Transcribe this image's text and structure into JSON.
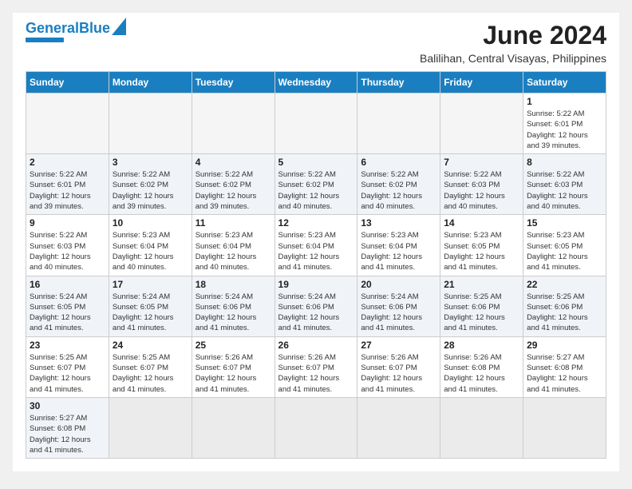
{
  "header": {
    "logo_general": "General",
    "logo_blue": "Blue",
    "month_year": "June 2024",
    "location": "Balilihan, Central Visayas, Philippines"
  },
  "weekdays": [
    "Sunday",
    "Monday",
    "Tuesday",
    "Wednesday",
    "Thursday",
    "Friday",
    "Saturday"
  ],
  "rows": [
    {
      "shaded": false,
      "days": [
        {
          "num": "",
          "empty": true
        },
        {
          "num": "",
          "empty": true
        },
        {
          "num": "",
          "empty": true
        },
        {
          "num": "",
          "empty": true
        },
        {
          "num": "",
          "empty": true
        },
        {
          "num": "",
          "empty": true
        },
        {
          "num": "1",
          "sunrise": "5:22 AM",
          "sunset": "6:01 PM",
          "daylight": "12 hours and 39 minutes."
        }
      ]
    },
    {
      "shaded": true,
      "days": [
        {
          "num": "2",
          "sunrise": "5:22 AM",
          "sunset": "6:01 PM",
          "daylight": "12 hours and 39 minutes."
        },
        {
          "num": "3",
          "sunrise": "5:22 AM",
          "sunset": "6:02 PM",
          "daylight": "12 hours and 39 minutes."
        },
        {
          "num": "4",
          "sunrise": "5:22 AM",
          "sunset": "6:02 PM",
          "daylight": "12 hours and 39 minutes."
        },
        {
          "num": "5",
          "sunrise": "5:22 AM",
          "sunset": "6:02 PM",
          "daylight": "12 hours and 40 minutes."
        },
        {
          "num": "6",
          "sunrise": "5:22 AM",
          "sunset": "6:02 PM",
          "daylight": "12 hours and 40 minutes."
        },
        {
          "num": "7",
          "sunrise": "5:22 AM",
          "sunset": "6:03 PM",
          "daylight": "12 hours and 40 minutes."
        },
        {
          "num": "8",
          "sunrise": "5:22 AM",
          "sunset": "6:03 PM",
          "daylight": "12 hours and 40 minutes."
        }
      ]
    },
    {
      "shaded": false,
      "days": [
        {
          "num": "9",
          "sunrise": "5:22 AM",
          "sunset": "6:03 PM",
          "daylight": "12 hours and 40 minutes."
        },
        {
          "num": "10",
          "sunrise": "5:23 AM",
          "sunset": "6:04 PM",
          "daylight": "12 hours and 40 minutes."
        },
        {
          "num": "11",
          "sunrise": "5:23 AM",
          "sunset": "6:04 PM",
          "daylight": "12 hours and 40 minutes."
        },
        {
          "num": "12",
          "sunrise": "5:23 AM",
          "sunset": "6:04 PM",
          "daylight": "12 hours and 41 minutes."
        },
        {
          "num": "13",
          "sunrise": "5:23 AM",
          "sunset": "6:04 PM",
          "daylight": "12 hours and 41 minutes."
        },
        {
          "num": "14",
          "sunrise": "5:23 AM",
          "sunset": "6:05 PM",
          "daylight": "12 hours and 41 minutes."
        },
        {
          "num": "15",
          "sunrise": "5:23 AM",
          "sunset": "6:05 PM",
          "daylight": "12 hours and 41 minutes."
        }
      ]
    },
    {
      "shaded": true,
      "days": [
        {
          "num": "16",
          "sunrise": "5:24 AM",
          "sunset": "6:05 PM",
          "daylight": "12 hours and 41 minutes."
        },
        {
          "num": "17",
          "sunrise": "5:24 AM",
          "sunset": "6:05 PM",
          "daylight": "12 hours and 41 minutes."
        },
        {
          "num": "18",
          "sunrise": "5:24 AM",
          "sunset": "6:06 PM",
          "daylight": "12 hours and 41 minutes."
        },
        {
          "num": "19",
          "sunrise": "5:24 AM",
          "sunset": "6:06 PM",
          "daylight": "12 hours and 41 minutes."
        },
        {
          "num": "20",
          "sunrise": "5:24 AM",
          "sunset": "6:06 PM",
          "daylight": "12 hours and 41 minutes."
        },
        {
          "num": "21",
          "sunrise": "5:25 AM",
          "sunset": "6:06 PM",
          "daylight": "12 hours and 41 minutes."
        },
        {
          "num": "22",
          "sunrise": "5:25 AM",
          "sunset": "6:06 PM",
          "daylight": "12 hours and 41 minutes."
        }
      ]
    },
    {
      "shaded": false,
      "days": [
        {
          "num": "23",
          "sunrise": "5:25 AM",
          "sunset": "6:07 PM",
          "daylight": "12 hours and 41 minutes."
        },
        {
          "num": "24",
          "sunrise": "5:25 AM",
          "sunset": "6:07 PM",
          "daylight": "12 hours and 41 minutes."
        },
        {
          "num": "25",
          "sunrise": "5:26 AM",
          "sunset": "6:07 PM",
          "daylight": "12 hours and 41 minutes."
        },
        {
          "num": "26",
          "sunrise": "5:26 AM",
          "sunset": "6:07 PM",
          "daylight": "12 hours and 41 minutes."
        },
        {
          "num": "27",
          "sunrise": "5:26 AM",
          "sunset": "6:07 PM",
          "daylight": "12 hours and 41 minutes."
        },
        {
          "num": "28",
          "sunrise": "5:26 AM",
          "sunset": "6:08 PM",
          "daylight": "12 hours and 41 minutes."
        },
        {
          "num": "29",
          "sunrise": "5:27 AM",
          "sunset": "6:08 PM",
          "daylight": "12 hours and 41 minutes."
        }
      ]
    },
    {
      "shaded": true,
      "days": [
        {
          "num": "30",
          "sunrise": "5:27 AM",
          "sunset": "6:08 PM",
          "daylight": "12 hours and 41 minutes."
        },
        {
          "num": "",
          "empty": true
        },
        {
          "num": "",
          "empty": true
        },
        {
          "num": "",
          "empty": true
        },
        {
          "num": "",
          "empty": true
        },
        {
          "num": "",
          "empty": true
        },
        {
          "num": "",
          "empty": true
        }
      ]
    }
  ]
}
